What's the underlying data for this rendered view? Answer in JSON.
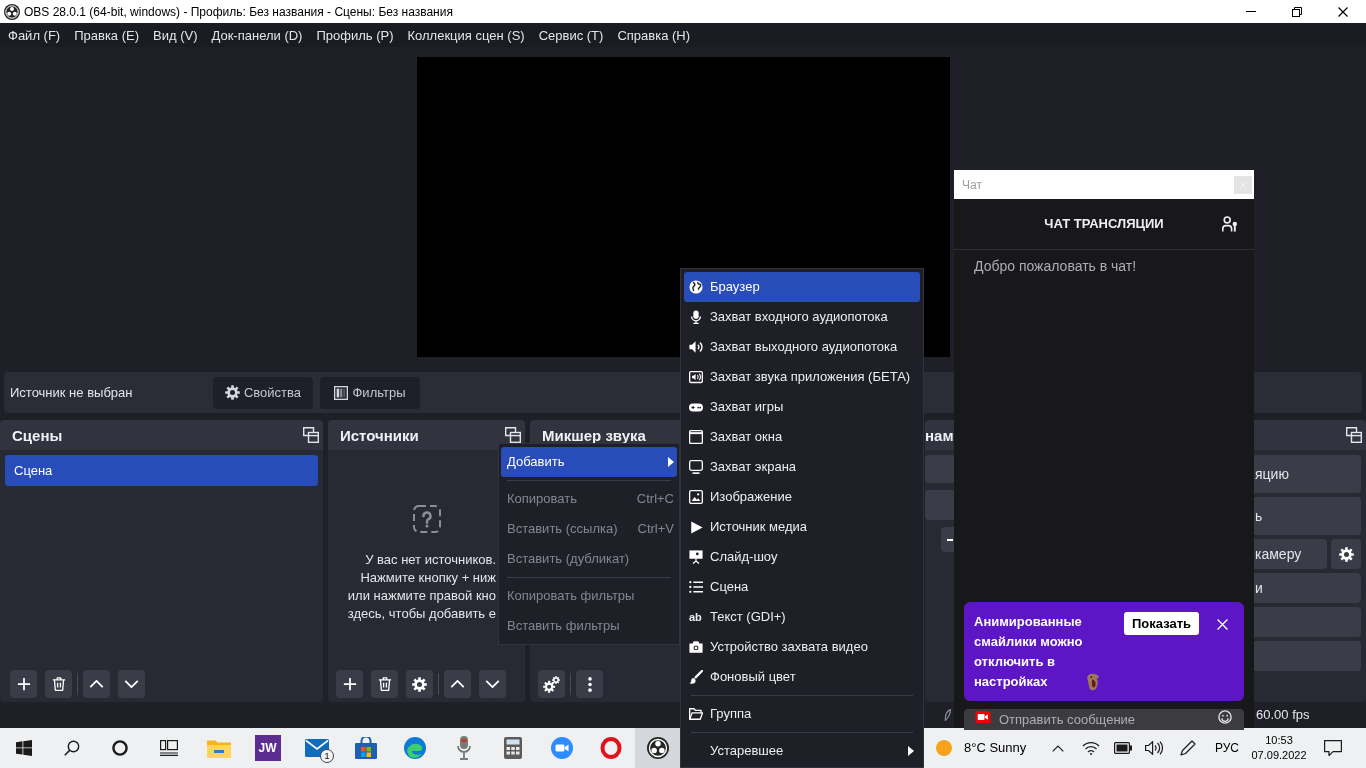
{
  "window": {
    "title": "OBS 28.0.1 (64-bit, windows) - Профиль: Без названия - Сцены: Без названия"
  },
  "menu_bar": [
    "Файл (F)",
    "Правка (E)",
    "Вид (V)",
    "Док-панели (D)",
    "Профиль (P)",
    "Коллекция сцен (S)",
    "Сервис (T)",
    "Справка (H)"
  ],
  "source_toolbar": {
    "status": "Источник не выбран",
    "buttons": [
      {
        "kind": "properties",
        "label": "Свойства"
      },
      {
        "kind": "filters",
        "label": "Фильтры"
      }
    ]
  },
  "docks": {
    "scenes": {
      "title": "Сцены",
      "items": [
        {
          "label": "Сцена",
          "selected": true
        }
      ]
    },
    "sources": {
      "title": "Источники",
      "empty_message": [
        "У вас нет источников.",
        "Нажмите кнопку + ниж",
        "или нажмите правой кно",
        "здесь, чтобы добавить е"
      ]
    },
    "mixer": {
      "title": "Микшер звука"
    },
    "transitions": {
      "title": "нам"
    },
    "controls": {
      "buttons": [
        {
          "kind": "button",
          "label": "яцию"
        },
        {
          "kind": "button",
          "label": "ь"
        },
        {
          "kind": "button_with_settings",
          "label": "камеру"
        },
        {
          "kind": "button",
          "label": "и"
        },
        {
          "kind": "blank"
        },
        {
          "kind": "blank"
        }
      ]
    }
  },
  "status_bar": {
    "fps": "60.00 fps"
  },
  "context_menu": {
    "items": [
      {
        "kind": "item",
        "label": "Добавить",
        "selected": true,
        "disabled": false,
        "submenu": true
      },
      {
        "kind": "separator"
      },
      {
        "kind": "item",
        "label": "Копировать",
        "shortcut": "Ctrl+C",
        "selected": false,
        "disabled": true,
        "submenu": false
      },
      {
        "kind": "item",
        "label": "Вставить (ссылка)",
        "shortcut": "Ctrl+V",
        "selected": false,
        "disabled": true,
        "submenu": false
      },
      {
        "kind": "item",
        "label": "Вставить (дубликат)",
        "selected": false,
        "disabled": true,
        "submenu": false
      },
      {
        "kind": "separator"
      },
      {
        "kind": "item",
        "label": "Копировать фильтры",
        "selected": false,
        "disabled": true,
        "submenu": false
      },
      {
        "kind": "item",
        "label": "Вставить фильтры",
        "selected": false,
        "disabled": true,
        "submenu": false
      }
    ]
  },
  "add_submenu": {
    "items": [
      {
        "kind": "browser",
        "label": "Браузер",
        "selected": true,
        "submenu": false
      },
      {
        "kind": "audio_input",
        "label": "Захват входного аудиопотока",
        "selected": false,
        "submenu": false
      },
      {
        "kind": "audio_output",
        "label": "Захват выходного аудиопотока",
        "selected": false,
        "submenu": false
      },
      {
        "kind": "app_audio",
        "label": "Захват звука приложения (БЕТА)",
        "selected": false,
        "submenu": false
      },
      {
        "kind": "game",
        "label": "Захват игры",
        "selected": false,
        "submenu": false
      },
      {
        "kind": "window",
        "label": "Захват окна",
        "selected": false,
        "submenu": false
      },
      {
        "kind": "display",
        "label": "Захват экрана",
        "selected": false,
        "submenu": false
      },
      {
        "kind": "image",
        "label": "Изображение",
        "selected": false,
        "submenu": false
      },
      {
        "kind": "media",
        "label": "Источник медиа",
        "selected": false,
        "submenu": false
      },
      {
        "kind": "slideshow",
        "label": "Слайд-шоу",
        "selected": false,
        "submenu": false
      },
      {
        "kind": "scene",
        "label": "Сцена",
        "selected": false,
        "submenu": false
      },
      {
        "kind": "text",
        "glyph": "ab",
        "label": "Текст (GDI+)",
        "selected": false,
        "submenu": false
      },
      {
        "kind": "video_device",
        "label": "Устройство захвата видео",
        "selected": false,
        "submenu": false
      },
      {
        "kind": "color",
        "label": "Фоновый цвет",
        "selected": false,
        "submenu": false
      },
      {
        "kind": "separator"
      },
      {
        "kind": "group",
        "label": "Группа",
        "selected": false,
        "submenu": false
      },
      {
        "kind": "separator"
      },
      {
        "kind": "plain",
        "label": "Устаревшее",
        "selected": false,
        "submenu": true
      }
    ]
  },
  "chat_window": {
    "title": "Чат",
    "header": "ЧАТ ТРАНСЛЯЦИИ",
    "messages": [
      "Добро пожаловать в чат!"
    ],
    "notification": {
      "text": "Анимированные смайлики можно отключить в настройках",
      "button": "Показать"
    },
    "input": {
      "placeholder": "Отправить сообщение"
    }
  },
  "taskbar": {
    "apps": [
      {
        "kind": "explorer",
        "selected": false
      },
      {
        "kind": "jw",
        "label": "JW",
        "selected": false
      },
      {
        "kind": "mail",
        "badge": "1",
        "selected": false
      },
      {
        "kind": "store",
        "selected": false
      },
      {
        "kind": "edge",
        "selected": false
      },
      {
        "kind": "microphone",
        "selected": false
      },
      {
        "kind": "calculator",
        "selected": false
      },
      {
        "kind": "zoom",
        "selected": false
      },
      {
        "kind": "opera",
        "selected": false
      },
      {
        "kind": "obs",
        "selected": true
      }
    ],
    "weather": "8°C Sunny",
    "language": "РУС",
    "time": "10:53",
    "date": "07.09.2022"
  }
}
